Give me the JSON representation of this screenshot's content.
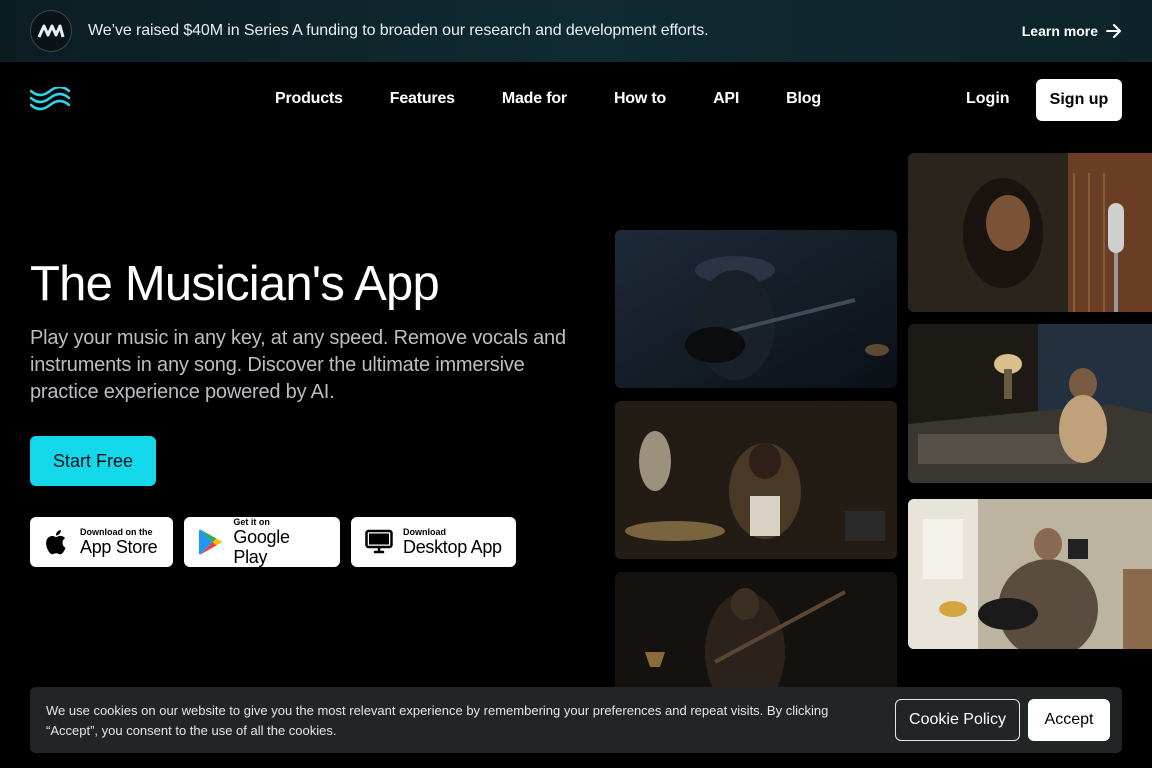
{
  "announcement": {
    "text": "We’ve raised $40M in Series A funding to broaden our research and development efforts.",
    "link_label": "Learn more",
    "logo_icon": "m-waves-logo-icon",
    "arrow_icon": "arrow-right-icon"
  },
  "nav": {
    "brand_icon": "waves-logo-icon",
    "links": [
      "Products",
      "Features",
      "Made for",
      "How to",
      "API",
      "Blog"
    ],
    "login_label": "Login",
    "signup_label": "Sign up"
  },
  "hero": {
    "title": "The Musician's App",
    "subtitle": "Play your music in any key, at any speed. Remove vocals and instruments in any song. Discover the ultimate immersive practice experience powered by AI.",
    "cta_label": "Start Free",
    "stores": [
      {
        "small": "Download on the",
        "big": "App Store",
        "icon": "apple-icon"
      },
      {
        "small": "Get it on",
        "big": "Google Play",
        "icon": "google-play-icon"
      },
      {
        "small": "Download",
        "big": "Desktop App",
        "icon": "desktop-icon"
      }
    ]
  },
  "cookie": {
    "text": "We use cookies on our website to give you the most relevant experience by remembering your preferences and repeat visits. By clicking “Accept”, you consent to the use of all the cookies.",
    "policy_label": "Cookie Policy",
    "accept_label": "Accept"
  },
  "colors": {
    "accent": "#13d8ea",
    "background": "#000000",
    "banner": "#0f2a31",
    "cookie_bg": "#222526"
  }
}
